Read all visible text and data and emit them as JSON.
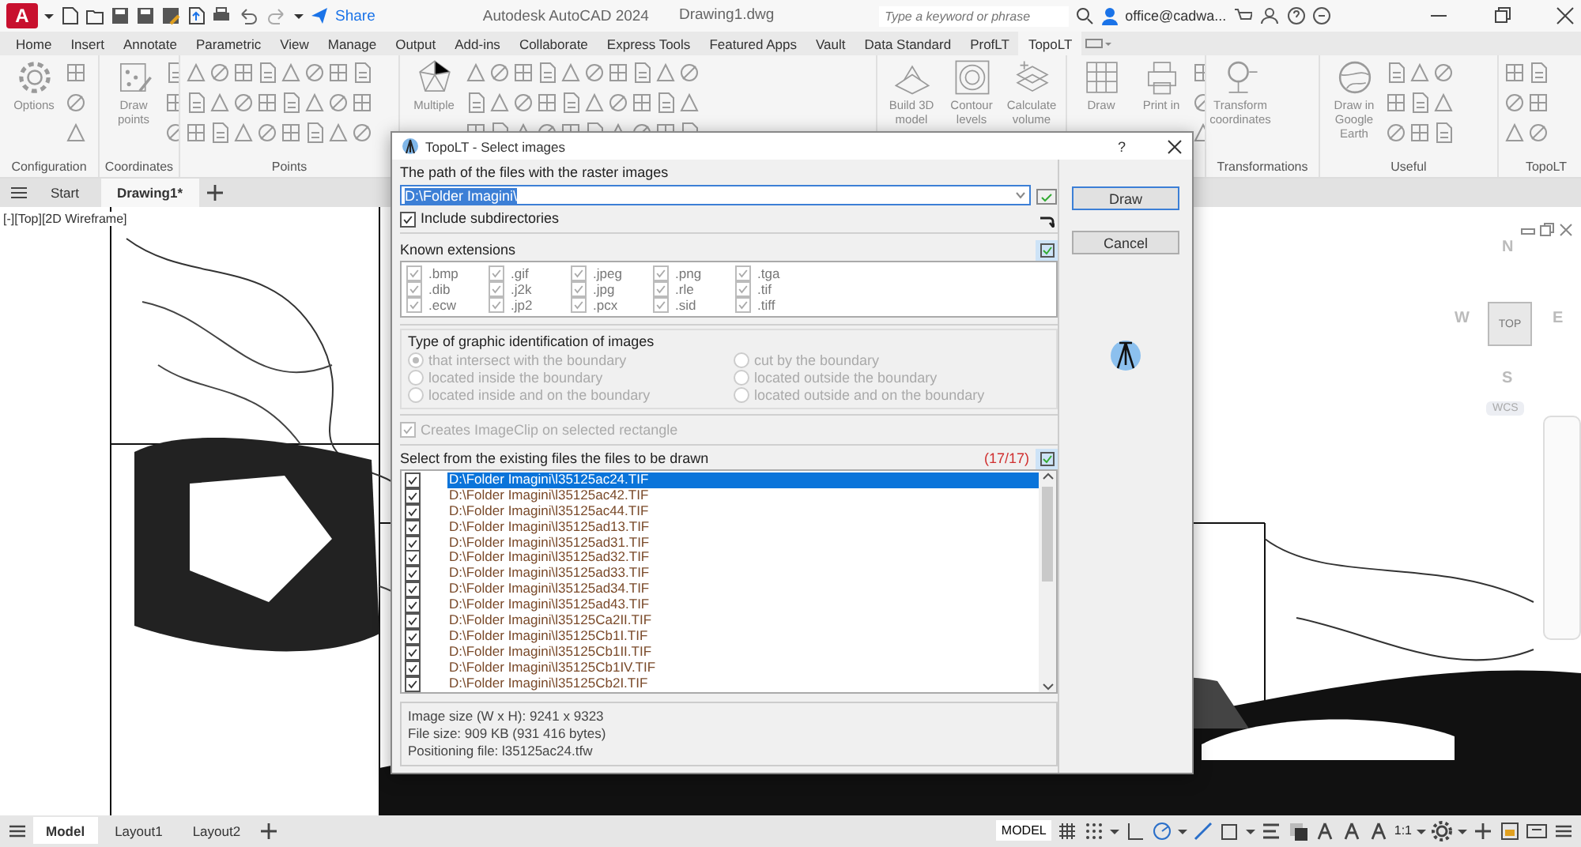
{
  "titlebar": {
    "logo": "A",
    "share": "Share",
    "app_title": "Autodesk AutoCAD 2024",
    "file_name": "Drawing1.dwg",
    "search": {
      "placeholder": "Type a keyword or phrase"
    },
    "user": "office@cadwa..."
  },
  "menu_tabs": [
    {
      "label": "Home",
      "selected": false
    },
    {
      "label": "Insert",
      "selected": false
    },
    {
      "label": "Annotate",
      "selected": false
    },
    {
      "label": "Parametric",
      "selected": false
    },
    {
      "label": "View",
      "selected": false
    },
    {
      "label": "Manage",
      "selected": false
    },
    {
      "label": "Output",
      "selected": false
    },
    {
      "label": "Add-ins",
      "selected": false
    },
    {
      "label": "Collaborate",
      "selected": false
    },
    {
      "label": "Express Tools",
      "selected": false
    },
    {
      "label": "Featured Apps",
      "selected": false
    },
    {
      "label": "Vault",
      "selected": false
    },
    {
      "label": "Data Standard",
      "selected": false
    },
    {
      "label": "ProfLT",
      "selected": false
    },
    {
      "label": "TopoLT",
      "selected": true
    }
  ],
  "ribbon_panels": [
    {
      "label": "Configuration",
      "tools": [
        {
          "label": "Options"
        }
      ]
    },
    {
      "label": "Coordinates",
      "tools": [
        {
          "label": "Draw points"
        }
      ]
    },
    {
      "label": "Points"
    },
    {
      "tools": [
        {
          "label": "Multiple"
        }
      ]
    },
    {
      "tools": [
        {
          "label": "Build 3D model"
        },
        {
          "label": "Contour levels"
        },
        {
          "label": "Calculate volume"
        }
      ]
    },
    {
      "tools": [
        {
          "label": "Draw"
        },
        {
          "label": "Print in"
        }
      ]
    },
    {
      "label": "Transformations",
      "tools": [
        {
          "label": "Transform coordinates"
        }
      ]
    },
    {
      "label": "Useful",
      "tools": [
        {
          "label": "Draw in Google Earth"
        }
      ]
    },
    {
      "label": "TopoLT"
    }
  ],
  "file_tabs": [
    {
      "label": "Start",
      "selected": false
    },
    {
      "label": "Drawing1*",
      "selected": true
    }
  ],
  "viewport": {
    "label": "[-][Top][2D Wireframe]",
    "viewcube": {
      "north": "N",
      "west": "W",
      "face": "TOP",
      "east": "E",
      "south": "S",
      "ucs": "WCS"
    }
  },
  "dialog": {
    "title": "TopoLT - Select images",
    "help": "?",
    "path_label": "The path of the files with the raster images",
    "path": "D:\\Folder Imagini\\",
    "include_subdirs": {
      "label": "Include subdirectories",
      "checked": true
    },
    "extensions_title": "Known extensions",
    "extensions": [
      {
        "label": ".bmp",
        "checked": true
      },
      {
        "label": ".gif",
        "checked": true
      },
      {
        "label": ".jpeg",
        "checked": true
      },
      {
        "label": ".png",
        "checked": true
      },
      {
        "label": ".tga",
        "checked": true
      },
      {
        "label": ".dib",
        "checked": true
      },
      {
        "label": ".j2k",
        "checked": true
      },
      {
        "label": ".jpg",
        "checked": true
      },
      {
        "label": ".rle",
        "checked": true
      },
      {
        "label": ".tif",
        "checked": true
      },
      {
        "label": ".ecw",
        "checked": true
      },
      {
        "label": ".jp2",
        "checked": true
      },
      {
        "label": ".pcx",
        "checked": true
      },
      {
        "label": ".sid",
        "checked": true
      },
      {
        "label": ".tiff",
        "checked": true
      }
    ],
    "identification": {
      "title": "Type of graphic identification of images",
      "disabled": true,
      "options": [
        {
          "label": "that intersect with the boundary",
          "selected": true
        },
        {
          "label": "cut by the boundary",
          "selected": false
        },
        {
          "label": "located inside the boundary",
          "selected": false
        },
        {
          "label": "located outside the boundary",
          "selected": false
        },
        {
          "label": "located inside and on the boundary",
          "selected": false
        },
        {
          "label": "located outside and on the boundary",
          "selected": false
        }
      ]
    },
    "imageclip": {
      "label": "Creates ImageClip on selected rectangle",
      "checked": true,
      "disabled": true
    },
    "files_title": "Select from the existing files the files to be drawn",
    "files_count": "(17/17)",
    "files": [
      {
        "name": "D:\\Folder Imagini\\l35125ac24.TIF",
        "checked": true,
        "selected": true
      },
      {
        "name": "D:\\Folder Imagini\\l35125ac42.TIF",
        "checked": true,
        "selected": false
      },
      {
        "name": "D:\\Folder Imagini\\l35125ac44.TIF",
        "checked": true,
        "selected": false
      },
      {
        "name": "D:\\Folder Imagini\\l35125ad13.TIF",
        "checked": true,
        "selected": false
      },
      {
        "name": "D:\\Folder Imagini\\l35125ad31.TIF",
        "checked": true,
        "selected": false
      },
      {
        "name": "D:\\Folder Imagini\\l35125ad32.TIF",
        "checked": true,
        "selected": false
      },
      {
        "name": "D:\\Folder Imagini\\l35125ad33.TIF",
        "checked": true,
        "selected": false
      },
      {
        "name": "D:\\Folder Imagini\\l35125ad34.TIF",
        "checked": true,
        "selected": false
      },
      {
        "name": "D:\\Folder Imagini\\l35125ad43.TIF",
        "checked": true,
        "selected": false
      },
      {
        "name": "D:\\Folder Imagini\\l35125Ca2II.TIF",
        "checked": true,
        "selected": false
      },
      {
        "name": "D:\\Folder Imagini\\l35125Cb1I.TIF",
        "checked": true,
        "selected": false
      },
      {
        "name": "D:\\Folder Imagini\\l35125Cb1II.TIF",
        "checked": true,
        "selected": false
      },
      {
        "name": "D:\\Folder Imagini\\l35125Cb1IV.TIF",
        "checked": true,
        "selected": false
      },
      {
        "name": "D:\\Folder Imagini\\l35125Cb2I.TIF",
        "checked": true,
        "selected": false
      }
    ],
    "info": [
      "Image size (W x H): 9241 x 9323",
      "File size: 909 KB (931 416 bytes)",
      "Positioning file: l35125ac24.tfw"
    ],
    "buttons": [
      {
        "label": "Draw",
        "default": true
      },
      {
        "label": "Cancel",
        "default": false
      }
    ]
  },
  "status_bar": {
    "layout_tabs": [
      {
        "label": "Model",
        "selected": true
      },
      {
        "label": "Layout1",
        "selected": false
      },
      {
        "label": "Layout2",
        "selected": false
      }
    ],
    "space": "MODEL",
    "scale": "1:1"
  }
}
